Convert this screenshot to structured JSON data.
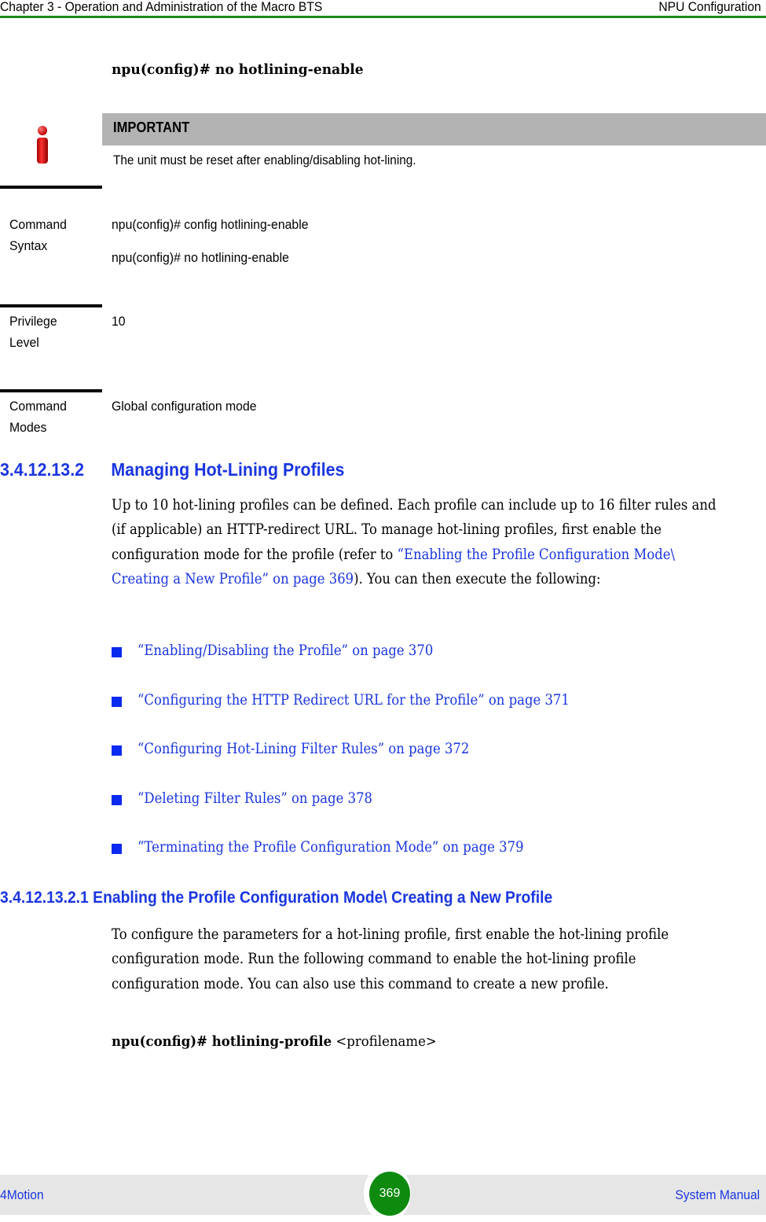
{
  "header": {
    "chapter": "Chapter 3 - Operation and Administration of the Macro BTS",
    "section": "NPU Configuration",
    "rule_color": "#1a8a1a"
  },
  "intro_command": "npu(config)# no hotlining-enable",
  "important": {
    "icon": "info-icon",
    "title": "IMPORTANT",
    "text": "The unit must be reset after enabling/disabling hot-lining."
  },
  "command_table": [
    {
      "label": "Command Syntax",
      "values": [
        "npu(config)# config hotlining-enable",
        "npu(config)# no hotlining-enable"
      ]
    },
    {
      "label": "Privilege Level",
      "values": [
        "10"
      ]
    },
    {
      "label": "Command Modes",
      "values": [
        "Global configuration mode"
      ]
    }
  ],
  "section1": {
    "number": "3.4.12.13.2",
    "title": "Managing Hot-Lining Profiles",
    "para_before": "Up to 10 hot-lining profiles can be defined. Each profile can include up to 16 filter rules and (if applicable) an HTTP-redirect URL. To manage hot-lining profiles, first enable the configuration mode for the profile (refer to ",
    "para_link": "“Enabling the Profile Configuration Mode\\ Creating a New Profile” on page 369",
    "para_after": "). You can then execute the following:",
    "bullets": [
      "“Enabling/Disabling the Profile” on page 370",
      "“Configuring the HTTP Redirect URL for the Profile” on page 371",
      "“Configuring Hot-Lining Filter Rules” on page 372",
      "“Deleting Filter Rules” on page 378",
      "“Terminating the Profile Configuration Mode” on page 379"
    ]
  },
  "section2": {
    "number": "3.4.12.13.2.1",
    "title": "Enabling the Profile Configuration Mode\\ Creating a New Profile",
    "para": "To configure the parameters for a hot-lining profile, first enable the hot-lining profile configuration mode. Run the following command to enable the hot-lining profile configuration mode. You can also use this command to create a new profile.",
    "command_bold": "npu(config)# hotlining-profile",
    "command_arg": " <profilename>"
  },
  "footer": {
    "left": "4Motion",
    "page_number": "369",
    "right": "System Manual",
    "accent": "#0e8a0e"
  }
}
